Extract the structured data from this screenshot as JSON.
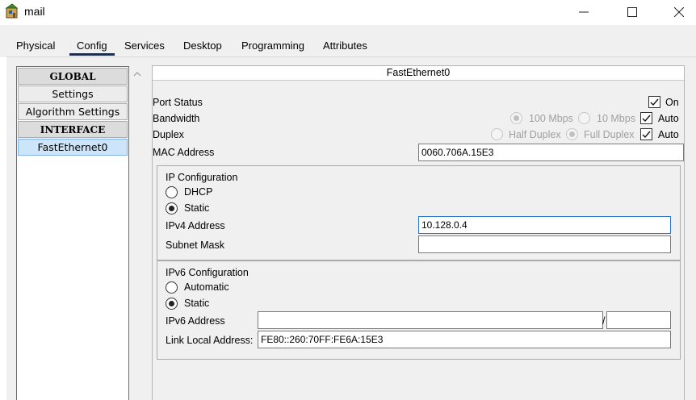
{
  "window": {
    "title": "mail"
  },
  "tabs": [
    {
      "label": "Physical"
    },
    {
      "label": "Config"
    },
    {
      "label": "Services"
    },
    {
      "label": "Desktop"
    },
    {
      "label": "Programming"
    },
    {
      "label": "Attributes"
    }
  ],
  "active_tab": "Config",
  "sidebar": {
    "items": [
      {
        "label": "GLOBAL",
        "kind": "header"
      },
      {
        "label": "Settings",
        "kind": "button"
      },
      {
        "label": "Algorithm Settings",
        "kind": "button"
      },
      {
        "label": "INTERFACE",
        "kind": "header"
      },
      {
        "label": "FastEthernet0",
        "kind": "selected"
      }
    ]
  },
  "panel": {
    "title": "FastEthernet0",
    "port_status": {
      "label": "Port Status",
      "on_label": "On",
      "on_checked": true
    },
    "bandwidth": {
      "label": "Bandwidth",
      "opt1": "100 Mbps",
      "opt2": "10 Mbps",
      "auto_label": "Auto",
      "auto_checked": true
    },
    "duplex": {
      "label": "Duplex",
      "opt1": "Half Duplex",
      "opt2": "Full Duplex",
      "auto_label": "Auto",
      "auto_checked": true
    },
    "mac": {
      "label": "MAC Address",
      "value": "0060.706A.15E3"
    },
    "ipv4": {
      "section_title": "IP Configuration",
      "dhcp_label": "DHCP",
      "static_label": "Static",
      "mode": "Static",
      "address_label": "IPv4 Address",
      "address_value": "10.128.0.4",
      "mask_label": "Subnet Mask",
      "mask_value": ""
    },
    "ipv6": {
      "section_title": "IPv6 Configuration",
      "auto_label": "Automatic",
      "static_label": "Static",
      "mode": "Static",
      "address_label": "IPv6 Address",
      "address_value": "",
      "prefix_sep": "/",
      "prefix_value": "",
      "link_local_label": "Link Local Address:",
      "link_local_value": "FE80::260:70FF:FE6A:15E3"
    }
  },
  "colors": {
    "tab_underline": "#1c2f4d",
    "selected_item": "#cce5fb",
    "focus_border": "#2a76c6"
  }
}
